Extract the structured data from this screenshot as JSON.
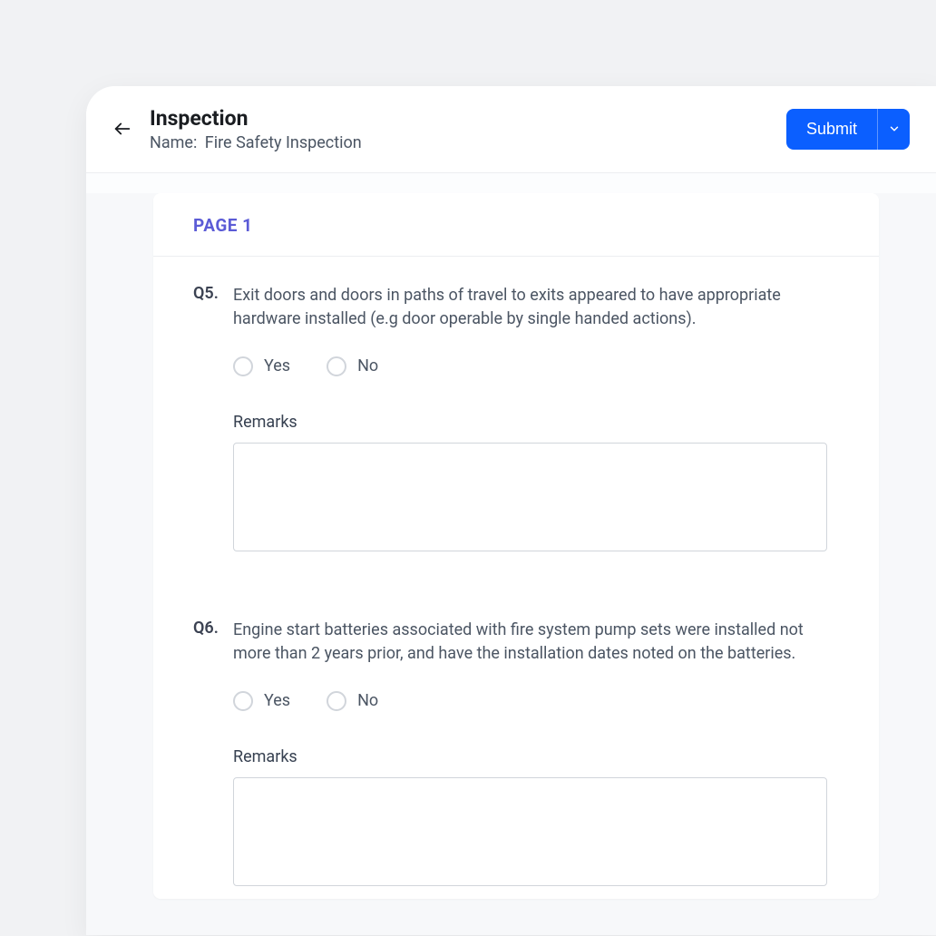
{
  "header": {
    "title": "Inspection",
    "name_label": "Name:",
    "name_value": "Fire Safety Inspection",
    "submit_label": "Submit"
  },
  "page_label": "PAGE 1",
  "questions": [
    {
      "num": "Q5.",
      "text": "Exit doors and doors in paths of travel to exits appeared to have appropriate hardware installed (e.g door operable by single handed actions).",
      "yes": "Yes",
      "no": "No",
      "remarks_label": "Remarks",
      "remarks_value": ""
    },
    {
      "num": "Q6.",
      "text": "Engine start batteries associated with fire system pump sets were installed not more than 2 years prior, and have the installation dates noted on the batteries.",
      "yes": "Yes",
      "no": "No",
      "remarks_label": "Remarks",
      "remarks_value": ""
    }
  ]
}
